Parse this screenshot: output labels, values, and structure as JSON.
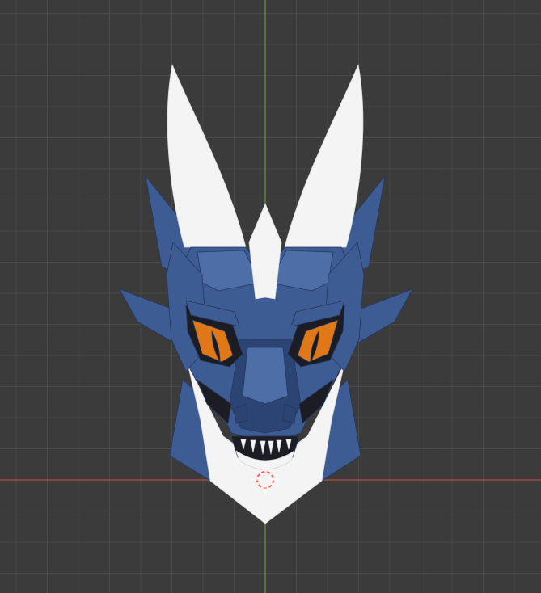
{
  "viewport": {
    "view": "front-orthographic",
    "background_color": "#3b3b3b",
    "grid_color": "#4a4a4a",
    "x_axis_color": "#b84848",
    "z_axis_color": "#6a9a3a",
    "grid_visible": true
  },
  "model": {
    "name": "dragon-head",
    "primary_color": "#3d5c94",
    "shade_color": "#2c4474",
    "highlight_color": "#4d6ea6",
    "horn_color": "#f4f4f4",
    "eye_color": "#e07818",
    "pupil_color": "#1a1a1a",
    "mouth_color": "#1c1c24"
  },
  "cursor_3d": {
    "outer_color": "#ff5a4a",
    "inner_color": "#ffffff"
  }
}
